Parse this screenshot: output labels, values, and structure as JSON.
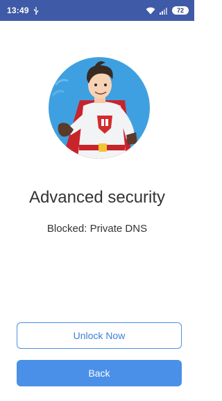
{
  "status_bar": {
    "time": "13:49",
    "battery": "72",
    "icons": [
      "usb-icon",
      "wifi-icon",
      "cellular-signal-icon",
      "battery-icon"
    ]
  },
  "hero": {
    "illustration": "superhero-mascot"
  },
  "content": {
    "title": "Advanced security",
    "subtitle": "Blocked: Private DNS"
  },
  "buttons": {
    "unlock_label": "Unlock Now",
    "back_label": "Back"
  },
  "colors": {
    "status_bar": "#3f5aa6",
    "accent": "#4a90e8",
    "hero_bg": "#3ea0e0",
    "text": "#333333"
  }
}
